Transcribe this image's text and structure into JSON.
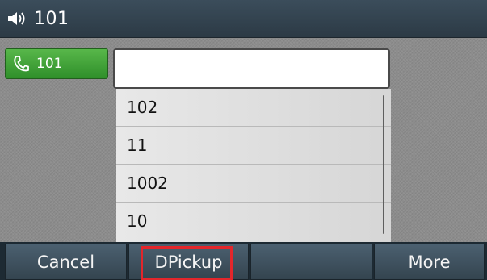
{
  "title_bar": {
    "icon": "speaker-icon",
    "text": "101"
  },
  "line_key": {
    "icon": "phone-icon",
    "label": "101",
    "color": "#3ea335"
  },
  "dial_input": {
    "value": "",
    "placeholder": ""
  },
  "suggestions": [
    "102",
    "11",
    "1002",
    "10"
  ],
  "softkeys": [
    {
      "label": "Cancel"
    },
    {
      "label": "DPickup",
      "highlighted": true,
      "highlight_color": "#e3262b"
    },
    {
      "label": ""
    },
    {
      "label": "More"
    }
  ]
}
